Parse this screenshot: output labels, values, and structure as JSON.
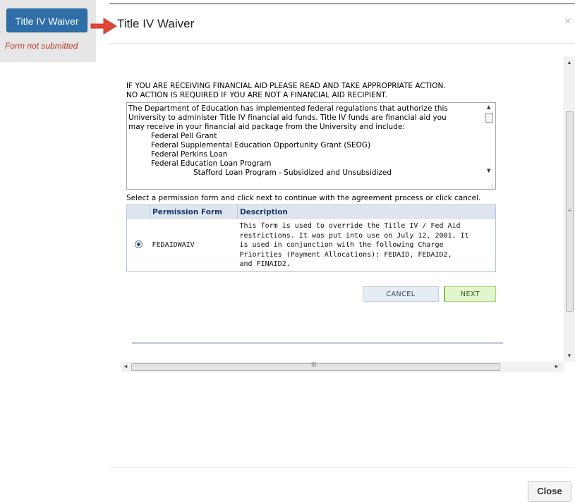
{
  "launcher": {
    "button_label": "Title IV Waiver",
    "status": "Form not submitted"
  },
  "modal": {
    "title": "Title IV Waiver",
    "close_x": "×",
    "close_button": "Close"
  },
  "form": {
    "notice_line1": "IF YOU ARE RECEIVING FINANCIAL AID PLEASE READ AND TAKE APPROPRIATE ACTION.",
    "notice_line2": "NO ACTION IS REQUIRED IF YOU ARE NOT A FINANCIAL AID RECIPIENT.",
    "terms": {
      "intro_line1": "The Department of Education has implemented federal regulations that authorize this",
      "intro_line2": "University to administer Title IV financial aid funds. Title IV funds are financial aid you",
      "intro_line3": "may receive in your financial aid package from the University and include:",
      "item1": "Federal Pell Grant",
      "item2": "Federal Supplemental Education Opportunity Grant (SEOG)",
      "item3": "Federal Perkins Loan",
      "item4": "Federal Education Loan Program",
      "subitem1": "Stafford Loan Program - Subsidized and Unsubsidized"
    },
    "select_text": "Select a permission form and click next to continue with the agreement process or click cancel.",
    "table": {
      "col_form": "Permission Form",
      "col_desc": "Description",
      "row_form": "FEDAIDWAIV",
      "row_desc_line1": "This form is used to override the Title IV / Fed Aid",
      "row_desc_line2": "restrictions.  It was put into use on July 12, 2001.  It",
      "row_desc_line3": "is used in conjunction with the following Charge",
      "row_desc_line4": "Priorities (Payment Allocations): FEDAID, FEDAID2,",
      "row_desc_line5": "and FINAID2."
    },
    "cancel_label": "CANCEL",
    "next_label": "NEXT"
  },
  "scrollbars": {
    "up": "▲",
    "down": "▼",
    "left": "◄",
    "right": "►",
    "v_grip": "≡",
    "h_grip": "III",
    "resize": ".:|"
  }
}
